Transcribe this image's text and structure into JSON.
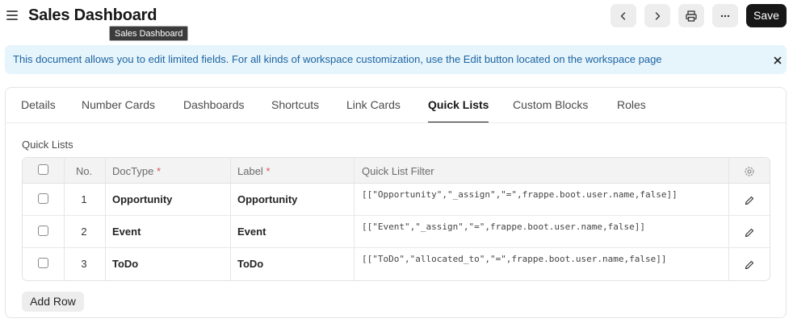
{
  "header": {
    "title": "Sales Dashboard",
    "tooltip": "Sales Dashboard",
    "save_label": "Save"
  },
  "alert": {
    "text": "This document allows you to edit limited fields. For all kinds of workspace customization, use the Edit button located on the workspace page"
  },
  "tabs": [
    {
      "label": "Details"
    },
    {
      "label": "Number Cards"
    },
    {
      "label": "Dashboards"
    },
    {
      "label": "Shortcuts"
    },
    {
      "label": "Link Cards"
    },
    {
      "label": "Quick Lists",
      "active": true
    },
    {
      "label": "Custom Blocks"
    },
    {
      "label": "Roles"
    }
  ],
  "section": {
    "label": "Quick Lists"
  },
  "table": {
    "columns": {
      "no": "No.",
      "doctype": "DocType",
      "label": "Label",
      "filter": "Quick List Filter",
      "required_mark": "*"
    },
    "rows": [
      {
        "no": "1",
        "doctype": "Opportunity",
        "label": "Opportunity",
        "filter": "[[\"Opportunity\",\"_assign\",\"=\",frappe.boot.user.name,false]]"
      },
      {
        "no": "2",
        "doctype": "Event",
        "label": "Event",
        "filter": "[[\"Event\",\"_assign\",\"=\",frappe.boot.user.name,false]]"
      },
      {
        "no": "3",
        "doctype": "ToDo",
        "label": "ToDo",
        "filter": "[[\"ToDo\",\"allocated_to\",\"=\",frappe.boot.user.name,false]]"
      }
    ],
    "add_row_label": "Add Row"
  },
  "icons": {
    "menu": "hamburger-icon",
    "prev": "chevron-left-icon",
    "next": "chevron-right-icon",
    "print": "printer-icon",
    "more": "more-horizontal-icon",
    "close": "close-icon",
    "settings": "gear-icon",
    "edit": "pencil-icon"
  },
  "colors": {
    "primary_button": "#171717",
    "alert_bg": "#e6f4fc",
    "alert_text": "#1d64a0",
    "required": "#e0535a"
  }
}
